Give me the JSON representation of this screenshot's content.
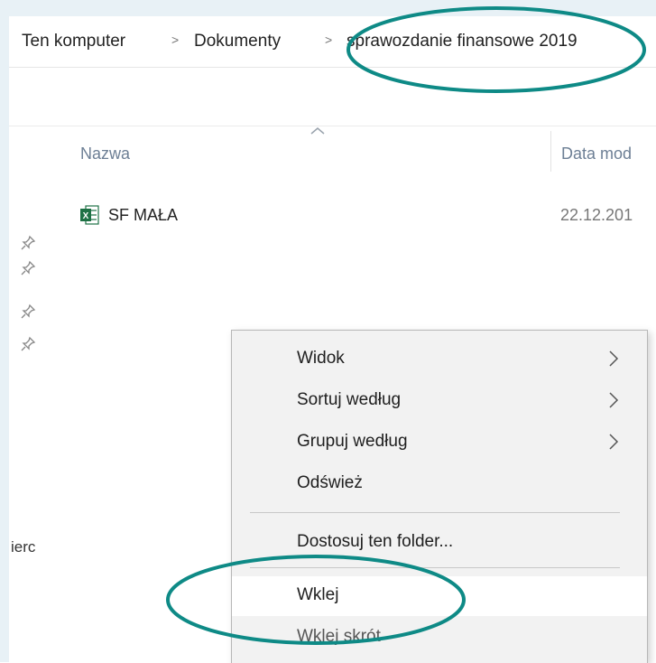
{
  "breadcrumb": {
    "items": [
      "Ten komputer",
      "Dokumenty",
      "sprawozdanie finansowe 2019"
    ],
    "separator": ">"
  },
  "columns": {
    "name": "Nazwa",
    "date": "Data mod"
  },
  "files": [
    {
      "name": "SF MAŁA",
      "date": "22.12.201",
      "icon": "excel-file-icon"
    }
  ],
  "nav": {
    "partial_label": "ierc"
  },
  "context_menu": {
    "items": [
      {
        "label": "Widok",
        "submenu": true
      },
      {
        "label": "Sortuj według",
        "submenu": true
      },
      {
        "label": "Grupuj według",
        "submenu": true
      },
      {
        "label": "Odśwież",
        "submenu": false
      },
      {
        "label": "Dostosuj ten folder...",
        "submenu": false
      },
      {
        "label": "Wklej",
        "submenu": false
      },
      {
        "label": "Wklej skrót",
        "submenu": false
      }
    ]
  },
  "colors": {
    "annotation": "#0e8a86",
    "excel_green": "#1e7145",
    "header_text": "#6d7f95"
  }
}
